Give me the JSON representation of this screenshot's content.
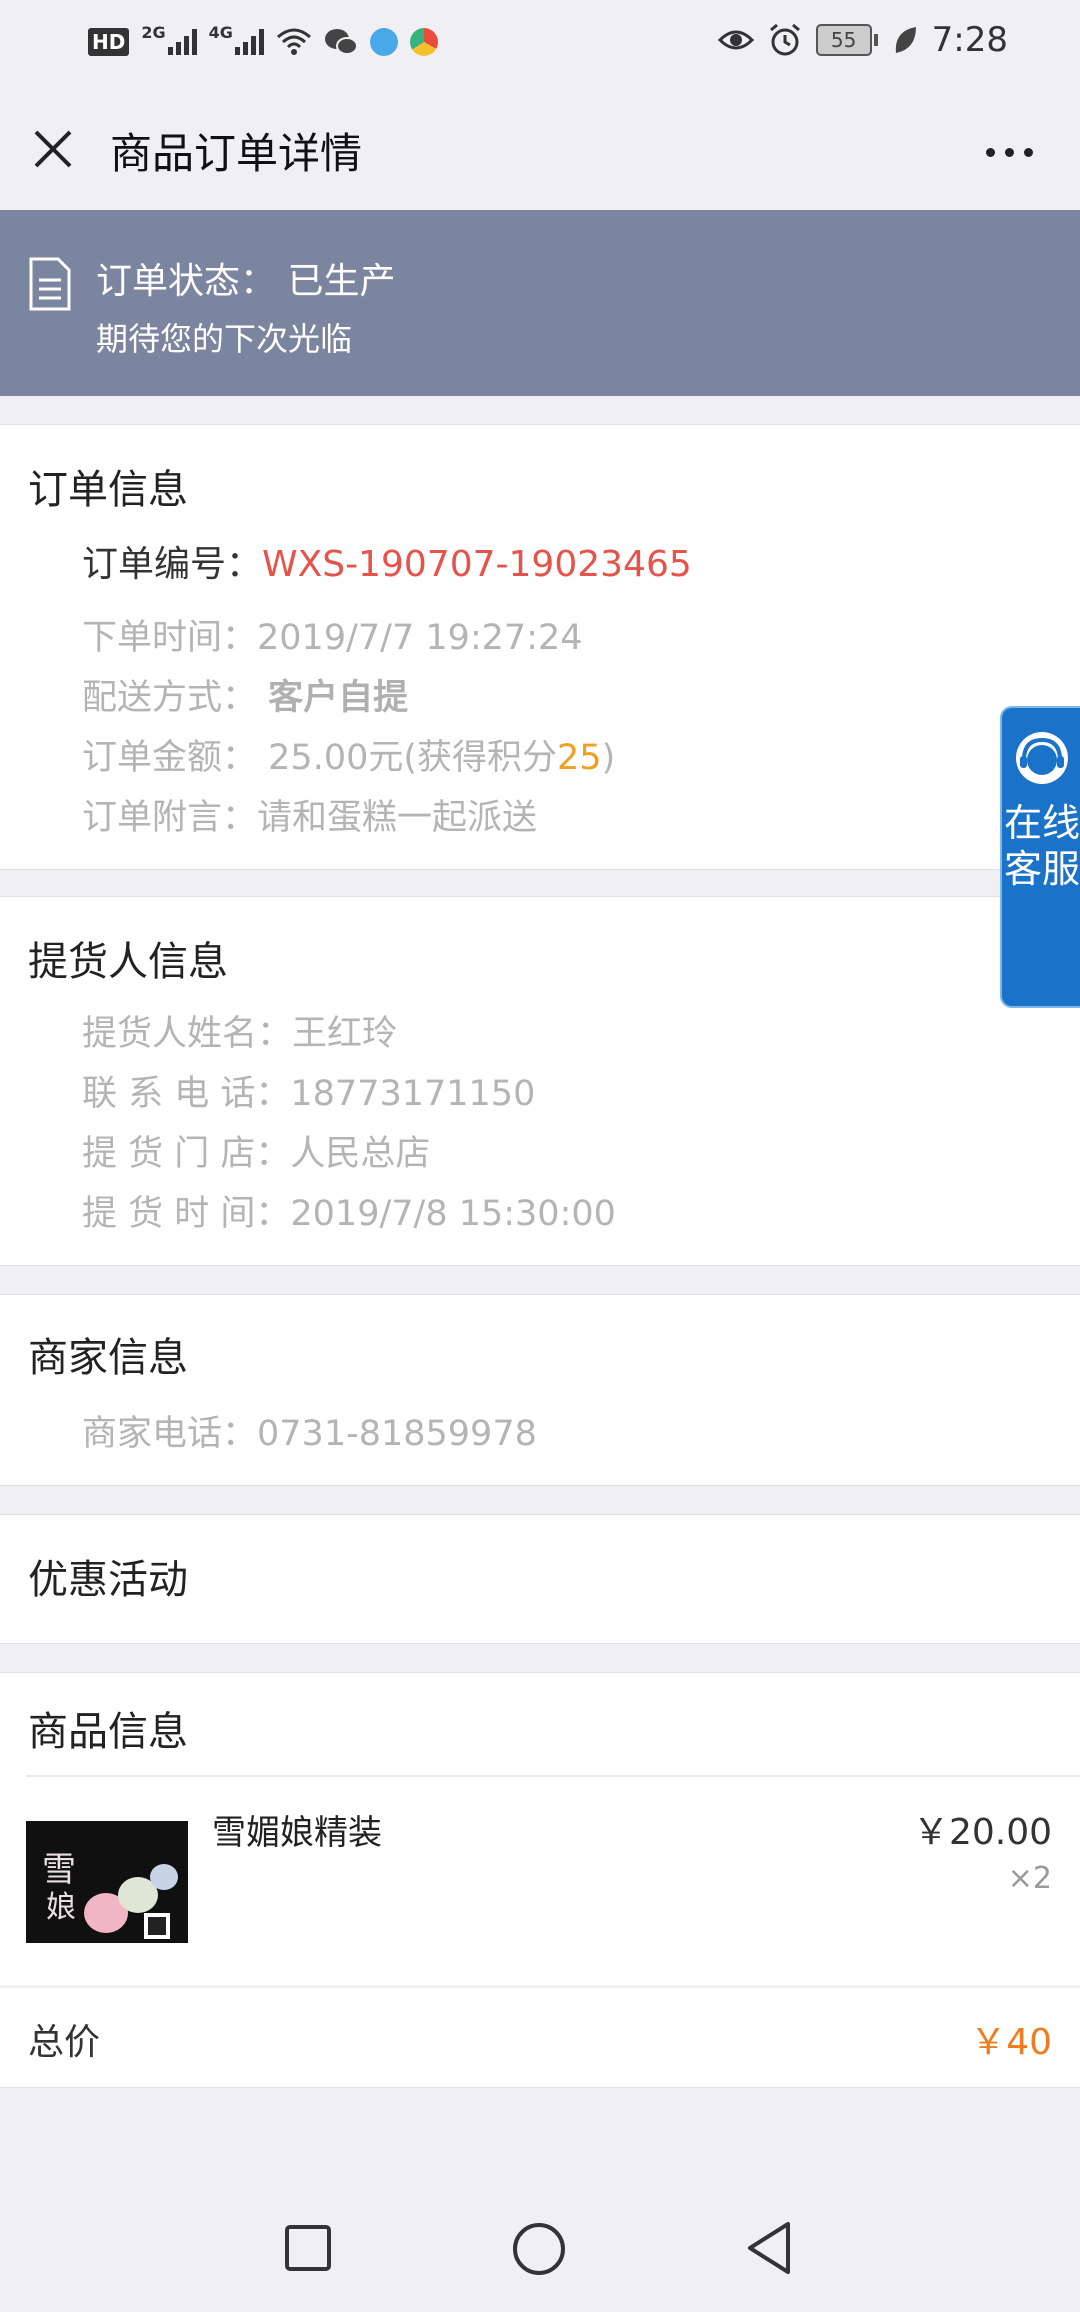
{
  "status_bar": {
    "hd": "HD",
    "hd_sub": "2",
    "net1": "2G",
    "net2": "4G",
    "battery": "55",
    "time": "7:28"
  },
  "header": {
    "title": "商品订单详情"
  },
  "banner": {
    "status_label": "订单状态：",
    "status_value": "已生产",
    "subtitle": "期待您的下次光临"
  },
  "order_info": {
    "title": "订单信息",
    "order_no_label": "订单编号：",
    "order_no": "WXS-190707-19023465",
    "time_label": "下单时间：",
    "time": "2019/7/7 19:27:24",
    "delivery_label": "配送方式：",
    "delivery": "客户自提",
    "amount_label": "订单金额：",
    "amount": "25.00元",
    "points_prefix": "(获得积分",
    "points": "25",
    "points_suffix": ")",
    "note_label": "订单附言：",
    "note": "请和蛋糕一起派送"
  },
  "pickup_info": {
    "title": "提货人信息",
    "name_label": "提货人姓名：",
    "name": "王红玲",
    "phone_label": "联 系 电 话：",
    "phone": "18773171150",
    "store_label": "提 货 门 店：",
    "store": "人民总店",
    "time_label": "提 货 时 间：",
    "time": "2019/7/8 15:30:00"
  },
  "merchant_info": {
    "title": "商家信息",
    "phone_label": "商家电话：",
    "phone": "0731-81859978"
  },
  "promotion": {
    "title": "优惠活动"
  },
  "products": {
    "title": "商品信息",
    "items": [
      {
        "name": "雪媚娘精装",
        "price": "￥20.00",
        "qty": "×2"
      }
    ],
    "total_label": "总价",
    "total": "￥40"
  },
  "service_tab": {
    "label": "在线客服"
  },
  "colors": {
    "banner": "#7b859f",
    "order_no": "#e5534b",
    "points": "#f0a020",
    "total": "#f07c1d",
    "service": "#1a73c8"
  }
}
